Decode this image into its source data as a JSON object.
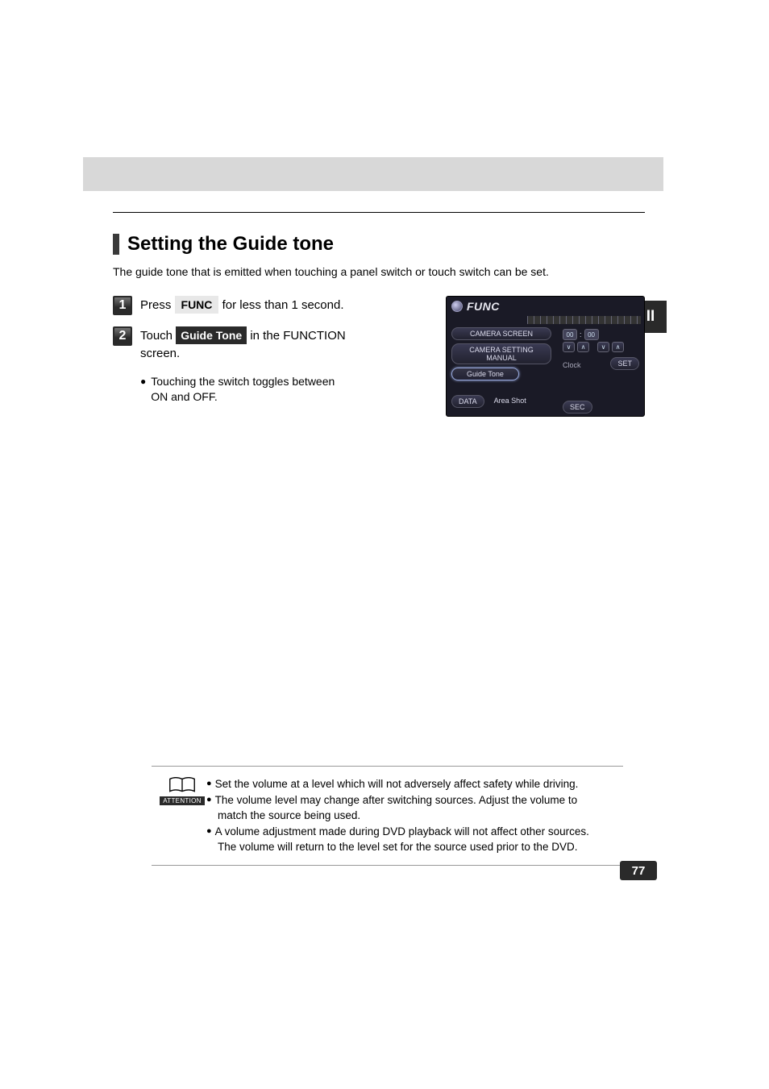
{
  "sideTab": "II",
  "section": {
    "title": "Setting the Guide tone",
    "intro": "The guide tone that is emitted when touching a panel switch or touch switch can be set."
  },
  "steps": [
    {
      "num": "1",
      "pre": "Press ",
      "btn": "FUNC",
      "post": " for less than 1 second."
    },
    {
      "num": "2",
      "pre": "Touch ",
      "btn": "Guide Tone",
      "post": " in the FUNCTION screen.",
      "bullet": "Touching the switch toggles between ON and OFF."
    }
  ],
  "screenshot": {
    "title": "FUNC",
    "buttons": {
      "cameraScreen": "CAMERA SCREEN",
      "cameraSetting": "CAMERA SETTING  MANUAL",
      "guideTone": "Guide Tone",
      "data": "DATA",
      "areaShot": "Area Shot",
      "clock": "Clock",
      "set": "SET",
      "sec": "SEC"
    },
    "digits": {
      "hh": "00",
      "mm": "00",
      "colon": ":"
    }
  },
  "attention": {
    "label": "ATTENTION",
    "items": [
      [
        "Set the volume at a level which will not adversely affect safety while driving."
      ],
      [
        "The volume level may change after switching sources. Adjust the volume to",
        "match the source being used."
      ],
      [
        "A volume adjustment made during DVD playback will not affect other sources.",
        "The volume will return to the level set for the source used prior to the DVD."
      ]
    ]
  },
  "pageNumber": "77"
}
